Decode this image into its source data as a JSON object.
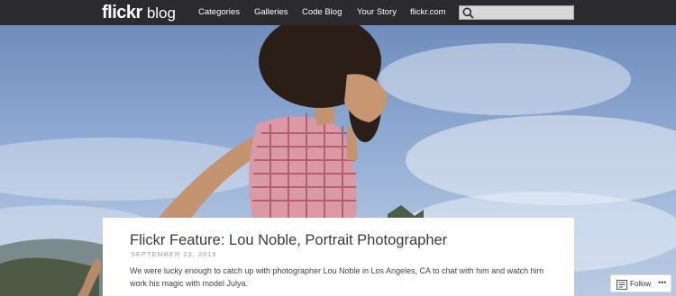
{
  "nav": {
    "brand": "flickr",
    "brand_sub": "blog",
    "links": [
      "Categories",
      "Galleries",
      "Code Blog",
      "Your Story",
      "flickr.com"
    ],
    "search_placeholder": ""
  },
  "post": {
    "title": "Flickr Feature: Lou Noble, Portrait Photographer",
    "date": "SEPTEMBER 23, 2019",
    "excerpt": "We were lucky enough to catch up with photographer Lou Noble in Los Angeles, CA to chat with him and watch him work his magic with model Julya."
  },
  "follow": {
    "label": "Follow",
    "more": "•••"
  },
  "colors": {
    "nav_bg": "#2b2b2f",
    "sky": "#8aa5cf",
    "card_bg": "#ffffff"
  },
  "icons": [
    "search-icon",
    "follow-icon"
  ]
}
